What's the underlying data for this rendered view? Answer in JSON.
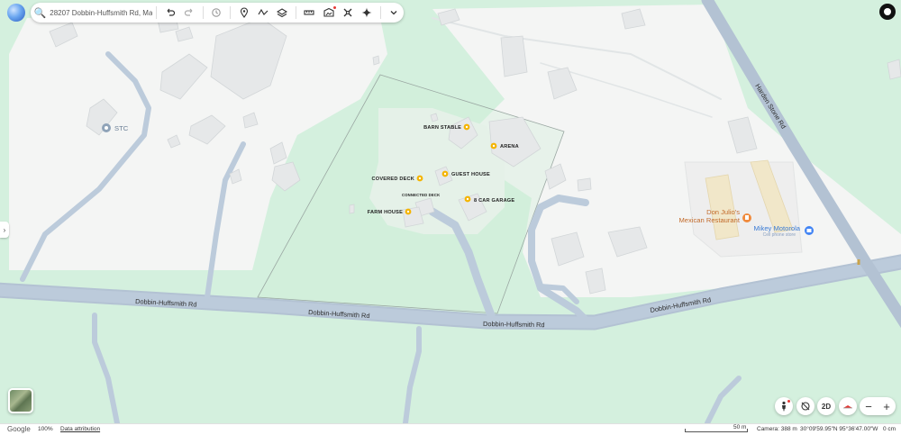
{
  "search": {
    "value": "28207 Dobbin-Huffsmith Rd, Mag"
  },
  "toolbar": {
    "icons": [
      "search-icon",
      "undo-icon",
      "redo-icon",
      "history-icon",
      "pin-icon",
      "path-icon",
      "layers-icon",
      "ruler-icon",
      "photo-icon",
      "streetview-icon",
      "sparkle-icon",
      "chevron-down-icon"
    ]
  },
  "map": {
    "building_labels": {
      "barn_stable": "BARN STABLE",
      "arena": "ARENA",
      "guest_house": "GUEST HOUSE",
      "covered_deck": "COVERED DECK",
      "connected_deck": "CONNECTED DECK",
      "car_garage": "8 CAR GARAGE",
      "farm_house": "FARM HOUSE"
    },
    "roads": {
      "main_west": "Dobbin-Huffsmith Rd",
      "main_mid": "Dobbin-Huffsmith Rd",
      "main_south": "Dobbin-Huffsmith Rd",
      "main_east": "Dobbin-Huffsmith Rd",
      "harden": "Harden Stone Rd"
    },
    "pois": {
      "stc": "STC",
      "restaurant_line1": "Don Julio's",
      "restaurant_line2": "Mexican Restaurant",
      "motorola": "Mikey Motorola",
      "motorola_sub": "Cell phone store"
    },
    "colors": {
      "grass": "#d4f0de",
      "land": "#f4f5f4",
      "road": "#b3c2d3",
      "building": "#e6e8e9",
      "pin": "#f4b400"
    }
  },
  "controls": {
    "mode_2d": "2D",
    "zoom_out": "−",
    "zoom_in": "+",
    "expand": "›"
  },
  "status": {
    "logo": "Google",
    "zoom": "100%",
    "attribution": "Data attribution",
    "scale": "50 m",
    "camera": "Camera: 388 m",
    "coords": "30°09'59.95\"N 95°36'47.00\"W",
    "elevation": "0 cm"
  }
}
